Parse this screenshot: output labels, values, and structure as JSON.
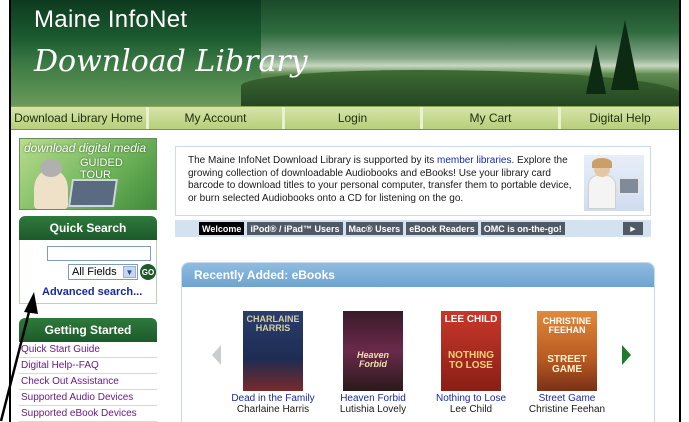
{
  "banner": {
    "line1": "Maine InfoNet",
    "line2": "Download Library"
  },
  "nav": {
    "tabs": [
      {
        "label": "Download Library Home"
      },
      {
        "label": "My Account"
      },
      {
        "label": "Login"
      },
      {
        "label": "My Cart"
      },
      {
        "label": "Digital Help"
      }
    ]
  },
  "promo": {
    "line1": "download digital media",
    "line2": "GUIDED TOUR"
  },
  "quick_search": {
    "title": "Quick Search",
    "input_value": "",
    "select_value": "All Fields",
    "go_label": "GO",
    "advanced_link": "Advanced search..."
  },
  "getting_started": {
    "title": "Getting Started",
    "items": [
      {
        "label": "Quick Start Guide"
      },
      {
        "label": "Digital Help--FAQ"
      },
      {
        "label": "Check Out Assistance"
      },
      {
        "label": "Supported Audio Devices"
      },
      {
        "label": "Supported eBook Devices"
      }
    ]
  },
  "intro": {
    "text_before": "The Maine InfoNet Download Library is supported by its ",
    "link": "member libraries",
    "text_after": ". Explore the growing collection of downloadable Audiobooks and eBooks! Use your library card barcode to download titles to your personal computer, transfer them to portable device, or burn selected Audiobooks onto a CD for listening on the go."
  },
  "info_tabs": [
    {
      "label": "Welcome"
    },
    {
      "label": "iPod® / iPad™ Users"
    },
    {
      "label": "Mac® Users"
    },
    {
      "label": "eBook Readers"
    },
    {
      "label": "OMC is on-the-go!"
    }
  ],
  "next_icon": "play-icon",
  "recent": {
    "title": "Recently Added: eBooks",
    "books": [
      {
        "title": "Dead in the Family",
        "author": "Charlaine Harris",
        "cover_text_top": "CHARLAINE HARRIS",
        "cover_color": "#2b3d6e"
      },
      {
        "title": "Heaven Forbid",
        "author": "Lutishia Lovely",
        "cover_text_top": "Heaven Forbid",
        "cover_color": "#5a2a4a"
      },
      {
        "title": "Nothing to Lose",
        "author": "Lee Child",
        "cover_text_top": "LEE CHILD",
        "cover_text_bottom": "NOTHING TO LOSE",
        "cover_color": "#a8281e"
      },
      {
        "title": "Street Game",
        "author": "Christine Feehan",
        "cover_text_top": "CHRISTINE FEEHAN",
        "cover_text_bottom": "STREET GAME",
        "cover_color": "#c2652a"
      }
    ]
  },
  "colors": {
    "nav_bg": "#c6da8e",
    "box_head": "#1d5a2b",
    "link": "#1a2aa0",
    "visited_link": "#6b1a8a",
    "panel_head": "#7fb0d8"
  }
}
